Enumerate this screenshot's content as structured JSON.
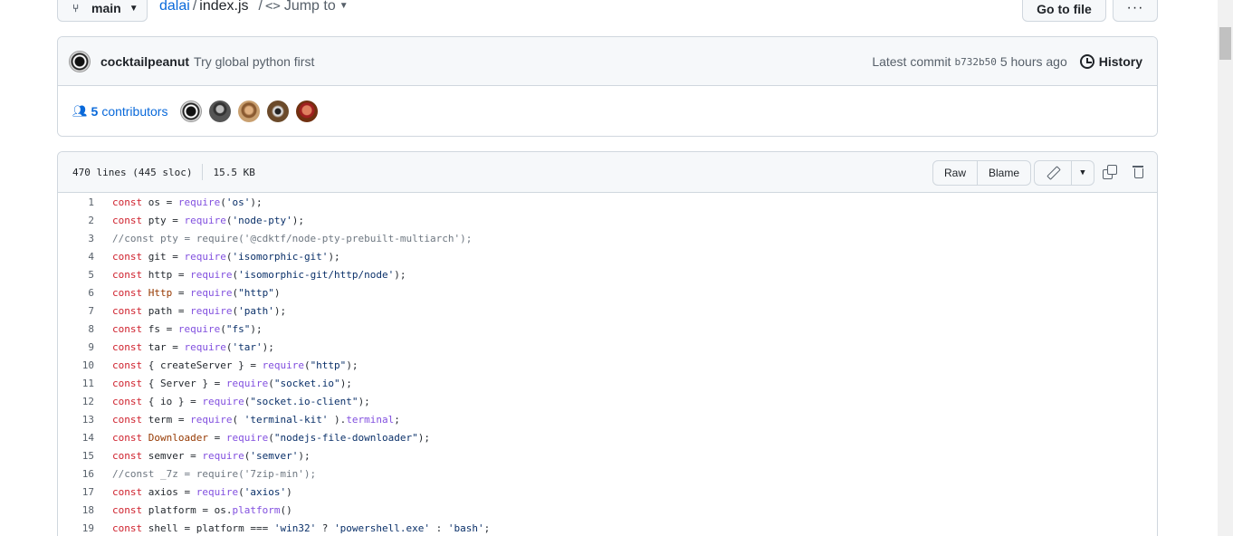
{
  "topbar": {
    "branch": "main",
    "repo": "dalai",
    "separator": "/",
    "file": "index.js",
    "jump_sep": "/",
    "jump_to": "Jump to",
    "goto_file": "Go to file",
    "more": "···"
  },
  "commit": {
    "author": "cocktailpeanut",
    "message": "Try global python first",
    "latest_label": "Latest commit",
    "sha": "b732b50",
    "time": "5 hours ago",
    "history": "History"
  },
  "contributors": {
    "count": "5",
    "label": "contributors"
  },
  "file_info": {
    "lines": "470 lines (445 sloc)",
    "size": "15.5 KB",
    "raw": "Raw",
    "blame": "Blame"
  },
  "code_lines": [
    {
      "n": "1",
      "parts": [
        [
          "k",
          "const"
        ],
        [
          "p",
          " os = "
        ],
        [
          "f",
          "require"
        ],
        [
          "p",
          "("
        ],
        [
          "s",
          "'os'"
        ],
        [
          "p",
          ");"
        ]
      ]
    },
    {
      "n": "2",
      "parts": [
        [
          "k",
          "const"
        ],
        [
          "p",
          " pty = "
        ],
        [
          "f",
          "require"
        ],
        [
          "p",
          "("
        ],
        [
          "s",
          "'node-pty'"
        ],
        [
          "p",
          ");"
        ]
      ]
    },
    {
      "n": "3",
      "parts": [
        [
          "c",
          "//const pty = require('@cdktf/node-pty-prebuilt-multiarch');"
        ]
      ]
    },
    {
      "n": "4",
      "parts": [
        [
          "k",
          "const"
        ],
        [
          "p",
          " git = "
        ],
        [
          "f",
          "require"
        ],
        [
          "p",
          "("
        ],
        [
          "s",
          "'isomorphic-git'"
        ],
        [
          "p",
          ");"
        ]
      ]
    },
    {
      "n": "5",
      "parts": [
        [
          "k",
          "const"
        ],
        [
          "p",
          " http = "
        ],
        [
          "f",
          "require"
        ],
        [
          "p",
          "("
        ],
        [
          "s",
          "'isomorphic-git/http/node'"
        ],
        [
          "p",
          ");"
        ]
      ]
    },
    {
      "n": "6",
      "parts": [
        [
          "k",
          "const"
        ],
        [
          "p",
          " "
        ],
        [
          "v",
          "Http"
        ],
        [
          "p",
          " = "
        ],
        [
          "f",
          "require"
        ],
        [
          "p",
          "("
        ],
        [
          "s",
          "\"http\""
        ],
        [
          "p",
          ")"
        ]
      ]
    },
    {
      "n": "7",
      "parts": [
        [
          "k",
          "const"
        ],
        [
          "p",
          " path = "
        ],
        [
          "f",
          "require"
        ],
        [
          "p",
          "("
        ],
        [
          "s",
          "'path'"
        ],
        [
          "p",
          ");"
        ]
      ]
    },
    {
      "n": "8",
      "parts": [
        [
          "k",
          "const"
        ],
        [
          "p",
          " fs = "
        ],
        [
          "f",
          "require"
        ],
        [
          "p",
          "("
        ],
        [
          "s",
          "\"fs\""
        ],
        [
          "p",
          ");"
        ]
      ]
    },
    {
      "n": "9",
      "parts": [
        [
          "k",
          "const"
        ],
        [
          "p",
          " tar = "
        ],
        [
          "f",
          "require"
        ],
        [
          "p",
          "("
        ],
        [
          "s",
          "'tar'"
        ],
        [
          "p",
          ");"
        ]
      ]
    },
    {
      "n": "10",
      "parts": [
        [
          "k",
          "const"
        ],
        [
          "p",
          " { createServer } = "
        ],
        [
          "f",
          "require"
        ],
        [
          "p",
          "("
        ],
        [
          "s",
          "\"http\""
        ],
        [
          "p",
          ");"
        ]
      ]
    },
    {
      "n": "11",
      "parts": [
        [
          "k",
          "const"
        ],
        [
          "p",
          " { Server } = "
        ],
        [
          "f",
          "require"
        ],
        [
          "p",
          "("
        ],
        [
          "s",
          "\"socket.io\""
        ],
        [
          "p",
          ");"
        ]
      ]
    },
    {
      "n": "12",
      "parts": [
        [
          "k",
          "const"
        ],
        [
          "p",
          " { io } = "
        ],
        [
          "f",
          "require"
        ],
        [
          "p",
          "("
        ],
        [
          "s",
          "\"socket.io-client\""
        ],
        [
          "p",
          ");"
        ]
      ]
    },
    {
      "n": "13",
      "parts": [
        [
          "k",
          "const"
        ],
        [
          "p",
          " term = "
        ],
        [
          "f",
          "require"
        ],
        [
          "p",
          "( "
        ],
        [
          "s",
          "'terminal-kit'"
        ],
        [
          "p",
          " )."
        ],
        [
          "f",
          "terminal"
        ],
        [
          "p",
          ";"
        ]
      ]
    },
    {
      "n": "14",
      "parts": [
        [
          "k",
          "const"
        ],
        [
          "p",
          " "
        ],
        [
          "v",
          "Downloader"
        ],
        [
          "p",
          " = "
        ],
        [
          "f",
          "require"
        ],
        [
          "p",
          "("
        ],
        [
          "s",
          "\"nodejs-file-downloader\""
        ],
        [
          "p",
          ");"
        ]
      ]
    },
    {
      "n": "15",
      "parts": [
        [
          "k",
          "const"
        ],
        [
          "p",
          " semver = "
        ],
        [
          "f",
          "require"
        ],
        [
          "p",
          "("
        ],
        [
          "s",
          "'semver'"
        ],
        [
          "p",
          ");"
        ]
      ]
    },
    {
      "n": "16",
      "parts": [
        [
          "c",
          "//const _7z = require('7zip-min');"
        ]
      ]
    },
    {
      "n": "17",
      "parts": [
        [
          "k",
          "const"
        ],
        [
          "p",
          " axios = "
        ],
        [
          "f",
          "require"
        ],
        [
          "p",
          "("
        ],
        [
          "s",
          "'axios'"
        ],
        [
          "p",
          ")"
        ]
      ]
    },
    {
      "n": "18",
      "parts": [
        [
          "k",
          "const"
        ],
        [
          "p",
          " platform = os."
        ],
        [
          "f",
          "platform"
        ],
        [
          "p",
          "()"
        ]
      ]
    },
    {
      "n": "19",
      "parts": [
        [
          "k",
          "const"
        ],
        [
          "p",
          " shell = platform === "
        ],
        [
          "s",
          "'win32'"
        ],
        [
          "p",
          " ? "
        ],
        [
          "s",
          "'powershell.exe'"
        ],
        [
          "p",
          " : "
        ],
        [
          "s",
          "'bash'"
        ],
        [
          "p",
          ";"
        ]
      ]
    }
  ]
}
